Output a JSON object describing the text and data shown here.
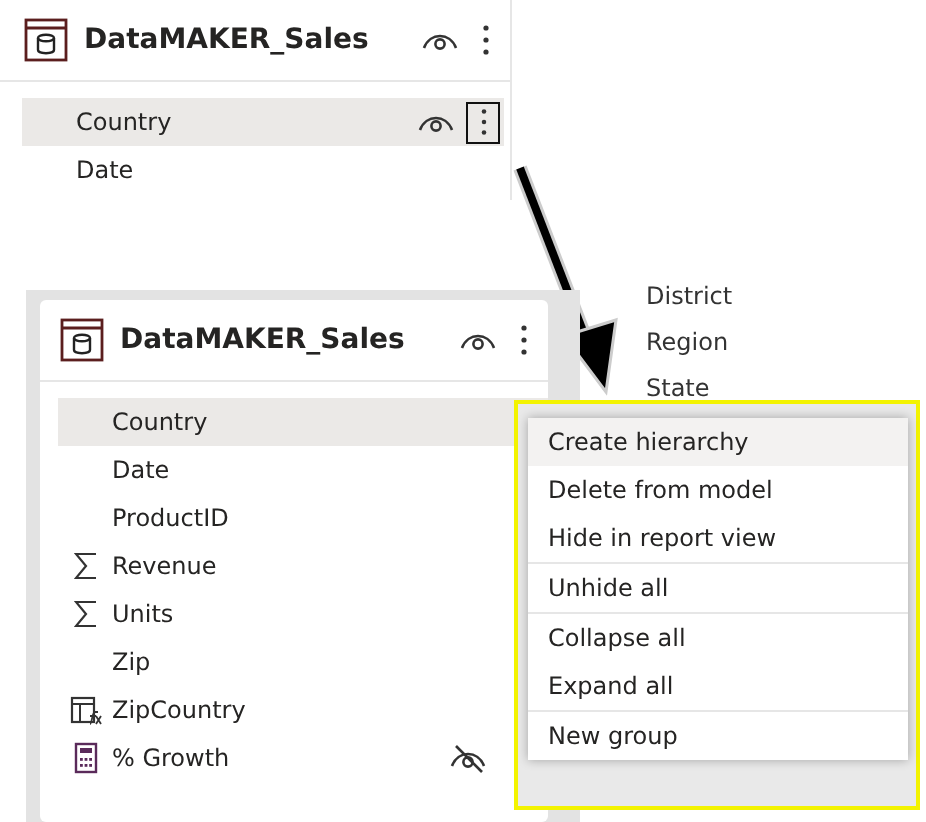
{
  "top_card": {
    "title": "DataMAKER_Sales",
    "fields": [
      {
        "name": "Country",
        "selected": true,
        "focused": true
      },
      {
        "name": "Date",
        "selected": false,
        "focused": false
      }
    ]
  },
  "card": {
    "title": "DataMAKER_Sales",
    "fields": [
      {
        "name": "Country",
        "kind": "column",
        "selected": true,
        "hidden": false
      },
      {
        "name": "Date",
        "kind": "column",
        "selected": false,
        "hidden": false
      },
      {
        "name": "ProductID",
        "kind": "column",
        "selected": false,
        "hidden": false
      },
      {
        "name": "Revenue",
        "kind": "sum",
        "selected": false,
        "hidden": false
      },
      {
        "name": "Units",
        "kind": "sum",
        "selected": false,
        "hidden": false
      },
      {
        "name": "Zip",
        "kind": "column",
        "selected": false,
        "hidden": false
      },
      {
        "name": "ZipCountry",
        "kind": "calc_column",
        "selected": false,
        "hidden": false
      },
      {
        "name": "% Growth",
        "kind": "measure",
        "selected": false,
        "hidden": true
      }
    ]
  },
  "hierarchy_levels": [
    "District",
    "Region",
    "State"
  ],
  "context_menu": {
    "items": [
      {
        "label": "Create hierarchy",
        "selected": true,
        "divider_before": false
      },
      {
        "label": "Delete from model",
        "selected": false,
        "divider_before": false
      },
      {
        "label": "Hide in report view",
        "selected": false,
        "divider_before": false
      },
      {
        "label": "Unhide all",
        "selected": false,
        "divider_before": true
      },
      {
        "label": "Collapse all",
        "selected": false,
        "divider_before": true
      },
      {
        "label": "Expand all",
        "selected": false,
        "divider_before": false
      },
      {
        "label": "New group",
        "selected": false,
        "divider_before": true
      }
    ]
  }
}
